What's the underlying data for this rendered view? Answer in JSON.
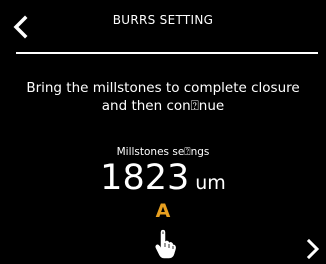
{
  "header": {
    "title": "BURRS SETTING",
    "back_icon": "chevron-left-icon"
  },
  "instruction": {
    "line1": "Bring the millstones to complete closure",
    "line2": "and then con⍰nue"
  },
  "millstones": {
    "label": "Millstones se⍰ngs",
    "value": "1823",
    "unit": "um"
  },
  "mode": {
    "letter": "A",
    "color": "#e8a020"
  },
  "touch_icon": "touch-hand-icon",
  "next_icon": "chevron-right-icon",
  "colors": {
    "background": "#000000",
    "text": "#ffffff",
    "accent": "#e8a020"
  }
}
